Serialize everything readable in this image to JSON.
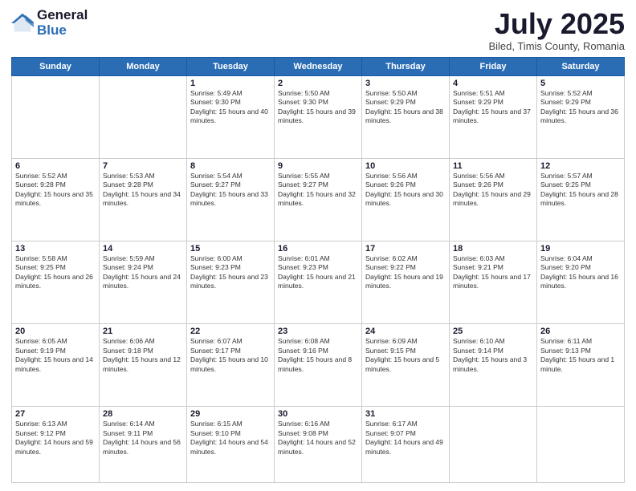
{
  "header": {
    "logo_general": "General",
    "logo_blue": "Blue",
    "month": "July 2025",
    "location": "Biled, Timis County, Romania"
  },
  "days_of_week": [
    "Sunday",
    "Monday",
    "Tuesday",
    "Wednesday",
    "Thursday",
    "Friday",
    "Saturday"
  ],
  "weeks": [
    [
      {
        "day": null
      },
      {
        "day": null
      },
      {
        "day": "1",
        "sunrise": "Sunrise: 5:49 AM",
        "sunset": "Sunset: 9:30 PM",
        "daylight": "Daylight: 15 hours and 40 minutes."
      },
      {
        "day": "2",
        "sunrise": "Sunrise: 5:50 AM",
        "sunset": "Sunset: 9:30 PM",
        "daylight": "Daylight: 15 hours and 39 minutes."
      },
      {
        "day": "3",
        "sunrise": "Sunrise: 5:50 AM",
        "sunset": "Sunset: 9:29 PM",
        "daylight": "Daylight: 15 hours and 38 minutes."
      },
      {
        "day": "4",
        "sunrise": "Sunrise: 5:51 AM",
        "sunset": "Sunset: 9:29 PM",
        "daylight": "Daylight: 15 hours and 37 minutes."
      },
      {
        "day": "5",
        "sunrise": "Sunrise: 5:52 AM",
        "sunset": "Sunset: 9:29 PM",
        "daylight": "Daylight: 15 hours and 36 minutes."
      }
    ],
    [
      {
        "day": "6",
        "sunrise": "Sunrise: 5:52 AM",
        "sunset": "Sunset: 9:28 PM",
        "daylight": "Daylight: 15 hours and 35 minutes."
      },
      {
        "day": "7",
        "sunrise": "Sunrise: 5:53 AM",
        "sunset": "Sunset: 9:28 PM",
        "daylight": "Daylight: 15 hours and 34 minutes."
      },
      {
        "day": "8",
        "sunrise": "Sunrise: 5:54 AM",
        "sunset": "Sunset: 9:27 PM",
        "daylight": "Daylight: 15 hours and 33 minutes."
      },
      {
        "day": "9",
        "sunrise": "Sunrise: 5:55 AM",
        "sunset": "Sunset: 9:27 PM",
        "daylight": "Daylight: 15 hours and 32 minutes."
      },
      {
        "day": "10",
        "sunrise": "Sunrise: 5:56 AM",
        "sunset": "Sunset: 9:26 PM",
        "daylight": "Daylight: 15 hours and 30 minutes."
      },
      {
        "day": "11",
        "sunrise": "Sunrise: 5:56 AM",
        "sunset": "Sunset: 9:26 PM",
        "daylight": "Daylight: 15 hours and 29 minutes."
      },
      {
        "day": "12",
        "sunrise": "Sunrise: 5:57 AM",
        "sunset": "Sunset: 9:25 PM",
        "daylight": "Daylight: 15 hours and 28 minutes."
      }
    ],
    [
      {
        "day": "13",
        "sunrise": "Sunrise: 5:58 AM",
        "sunset": "Sunset: 9:25 PM",
        "daylight": "Daylight: 15 hours and 26 minutes."
      },
      {
        "day": "14",
        "sunrise": "Sunrise: 5:59 AM",
        "sunset": "Sunset: 9:24 PM",
        "daylight": "Daylight: 15 hours and 24 minutes."
      },
      {
        "day": "15",
        "sunrise": "Sunrise: 6:00 AM",
        "sunset": "Sunset: 9:23 PM",
        "daylight": "Daylight: 15 hours and 23 minutes."
      },
      {
        "day": "16",
        "sunrise": "Sunrise: 6:01 AM",
        "sunset": "Sunset: 9:23 PM",
        "daylight": "Daylight: 15 hours and 21 minutes."
      },
      {
        "day": "17",
        "sunrise": "Sunrise: 6:02 AM",
        "sunset": "Sunset: 9:22 PM",
        "daylight": "Daylight: 15 hours and 19 minutes."
      },
      {
        "day": "18",
        "sunrise": "Sunrise: 6:03 AM",
        "sunset": "Sunset: 9:21 PM",
        "daylight": "Daylight: 15 hours and 17 minutes."
      },
      {
        "day": "19",
        "sunrise": "Sunrise: 6:04 AM",
        "sunset": "Sunset: 9:20 PM",
        "daylight": "Daylight: 15 hours and 16 minutes."
      }
    ],
    [
      {
        "day": "20",
        "sunrise": "Sunrise: 6:05 AM",
        "sunset": "Sunset: 9:19 PM",
        "daylight": "Daylight: 15 hours and 14 minutes."
      },
      {
        "day": "21",
        "sunrise": "Sunrise: 6:06 AM",
        "sunset": "Sunset: 9:18 PM",
        "daylight": "Daylight: 15 hours and 12 minutes."
      },
      {
        "day": "22",
        "sunrise": "Sunrise: 6:07 AM",
        "sunset": "Sunset: 9:17 PM",
        "daylight": "Daylight: 15 hours and 10 minutes."
      },
      {
        "day": "23",
        "sunrise": "Sunrise: 6:08 AM",
        "sunset": "Sunset: 9:16 PM",
        "daylight": "Daylight: 15 hours and 8 minutes."
      },
      {
        "day": "24",
        "sunrise": "Sunrise: 6:09 AM",
        "sunset": "Sunset: 9:15 PM",
        "daylight": "Daylight: 15 hours and 5 minutes."
      },
      {
        "day": "25",
        "sunrise": "Sunrise: 6:10 AM",
        "sunset": "Sunset: 9:14 PM",
        "daylight": "Daylight: 15 hours and 3 minutes."
      },
      {
        "day": "26",
        "sunrise": "Sunrise: 6:11 AM",
        "sunset": "Sunset: 9:13 PM",
        "daylight": "Daylight: 15 hours and 1 minute."
      }
    ],
    [
      {
        "day": "27",
        "sunrise": "Sunrise: 6:13 AM",
        "sunset": "Sunset: 9:12 PM",
        "daylight": "Daylight: 14 hours and 59 minutes."
      },
      {
        "day": "28",
        "sunrise": "Sunrise: 6:14 AM",
        "sunset": "Sunset: 9:11 PM",
        "daylight": "Daylight: 14 hours and 56 minutes."
      },
      {
        "day": "29",
        "sunrise": "Sunrise: 6:15 AM",
        "sunset": "Sunset: 9:10 PM",
        "daylight": "Daylight: 14 hours and 54 minutes."
      },
      {
        "day": "30",
        "sunrise": "Sunrise: 6:16 AM",
        "sunset": "Sunset: 9:08 PM",
        "daylight": "Daylight: 14 hours and 52 minutes."
      },
      {
        "day": "31",
        "sunrise": "Sunrise: 6:17 AM",
        "sunset": "Sunset: 9:07 PM",
        "daylight": "Daylight: 14 hours and 49 minutes."
      },
      {
        "day": null
      },
      {
        "day": null
      }
    ]
  ]
}
